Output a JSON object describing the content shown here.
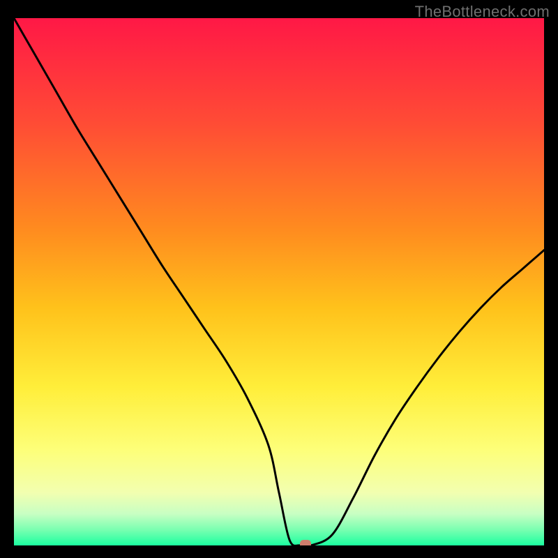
{
  "watermark": "TheBottleneck.com",
  "chart_data": {
    "type": "line",
    "title": "",
    "xlabel": "",
    "ylabel": "",
    "xlim": [
      0,
      100
    ],
    "ylim": [
      0,
      100
    ],
    "x": [
      0,
      4,
      8,
      12,
      16,
      20,
      24,
      28,
      32,
      36,
      40,
      44,
      48,
      50,
      52,
      54,
      56,
      60,
      64,
      68,
      72,
      76,
      80,
      84,
      88,
      92,
      96,
      100
    ],
    "values": [
      100,
      93,
      86,
      79,
      72.5,
      66,
      59.5,
      53,
      47,
      41,
      35,
      28,
      19,
      10,
      1,
      0,
      0,
      2,
      9,
      17,
      24,
      30,
      35.5,
      40.5,
      45,
      49,
      52.5,
      56
    ],
    "marker": {
      "x": 55,
      "y": 0.3,
      "color": "#cf7d6c"
    },
    "gradient_stops": [
      {
        "offset": 0.0,
        "color": "#ff1846"
      },
      {
        "offset": 0.2,
        "color": "#ff4c35"
      },
      {
        "offset": 0.4,
        "color": "#ff8b1f"
      },
      {
        "offset": 0.55,
        "color": "#ffc21b"
      },
      {
        "offset": 0.7,
        "color": "#ffee3a"
      },
      {
        "offset": 0.82,
        "color": "#fdff7a"
      },
      {
        "offset": 0.9,
        "color": "#f2ffb0"
      },
      {
        "offset": 0.94,
        "color": "#c8ffc3"
      },
      {
        "offset": 0.97,
        "color": "#7affb1"
      },
      {
        "offset": 1.0,
        "color": "#1bffa0"
      }
    ]
  }
}
